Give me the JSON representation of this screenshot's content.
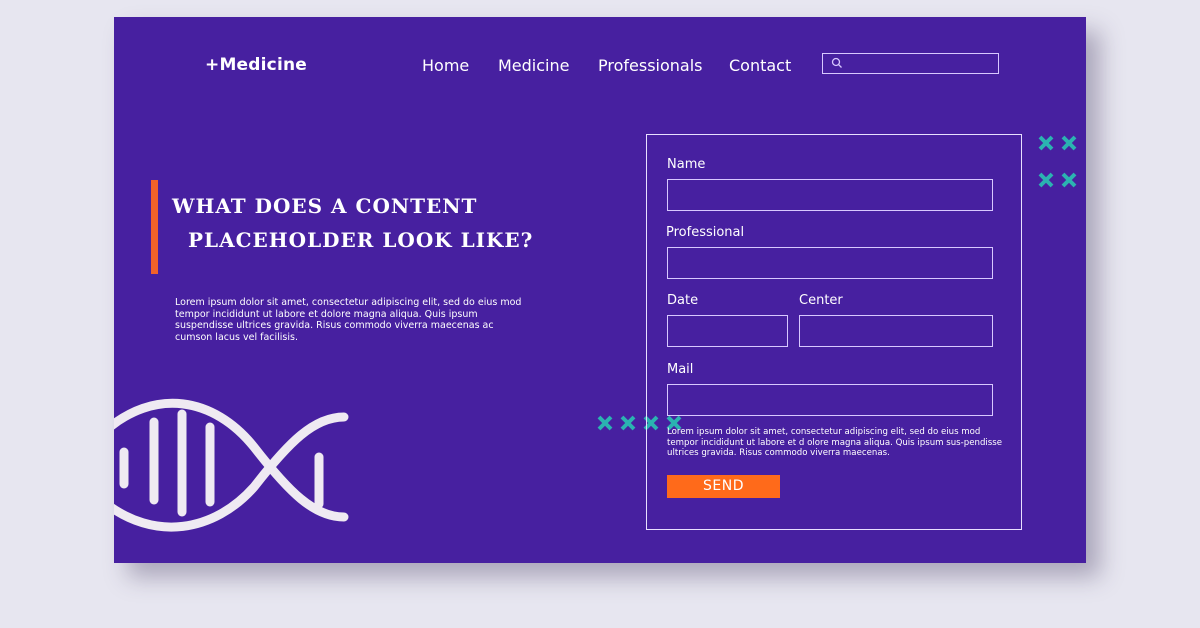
{
  "header": {
    "logo": "+Medicine",
    "nav": [
      "Home",
      "Medicine",
      "Professionals",
      "Contact"
    ],
    "search": {
      "placeholder": "",
      "icon": "search-icon"
    }
  },
  "hero": {
    "headline_line1": "WHAT DOES A CONTENT",
    "headline_line2": "PLACEHOLDER LOOK LIKE?",
    "body": "Lorem ipsum dolor sit amet, consectetur adipiscing elit, sed do eius mod tempor incididunt ut labore et dolore magna aliqua. Quis ipsum suspendisse ultrices gravida. Risus commodo viverra maecenas ac cumson lacus vel facilisis."
  },
  "form": {
    "labels": {
      "name": "Name",
      "professional": "Professional",
      "date": "Date",
      "center": "Center",
      "mail": "Mail"
    },
    "values": {
      "name": "",
      "professional": "",
      "date": "",
      "center": "",
      "mail": ""
    },
    "note": "Lorem ipsum dolor sit amet, consectetur adipiscing elit, sed do eius mod tempor incididunt ut labore et d olore magna aliqua. Quis ipsum sus-pendisse ultrices gravida. Risus commodo viverra maecenas.",
    "submit_label": "SEND"
  },
  "colors": {
    "background": "#4720a0",
    "accent": "#ff6a1a",
    "decor": "#2bb3b1",
    "outline": "#d8c8ff"
  }
}
